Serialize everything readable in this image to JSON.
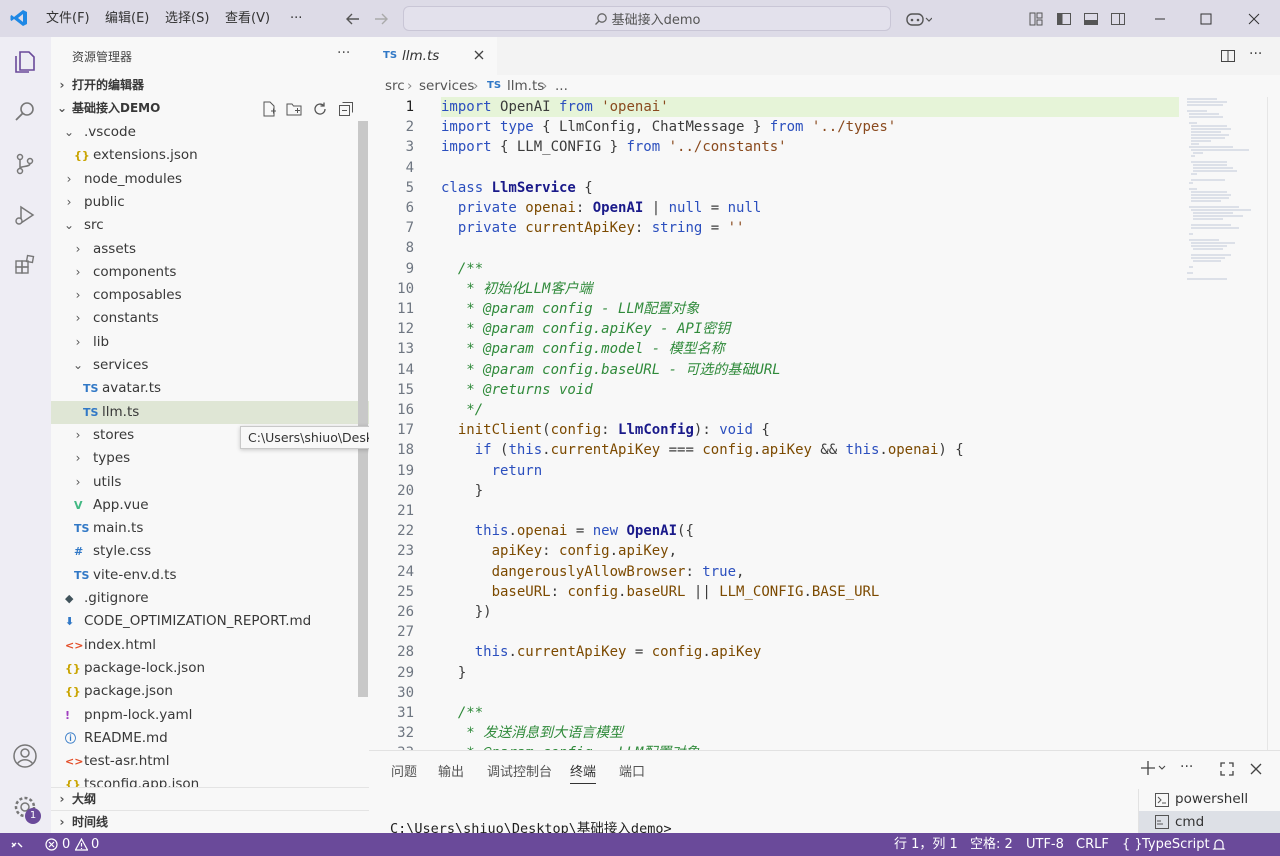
{
  "titlebar": {
    "menus": [
      "文件(F)",
      "编辑(E)",
      "选择(S)",
      "查看(V)"
    ],
    "more": "···",
    "search_text": "基础接入demo"
  },
  "sidebar": {
    "title": "资源管理器",
    "more": "···",
    "open_editors": "打开的编辑器",
    "project": "基础接入DEMO",
    "outline": "大纲",
    "timeline": "时间线",
    "items": [
      {
        "label": ".vscode",
        "chev": "v",
        "icon": "",
        "icon_color": ""
      },
      {
        "label": "extensions.json",
        "chev": "",
        "icon": "{}",
        "icon_color": "#c9a400"
      },
      {
        "label": "node_modules",
        "chev": ">",
        "icon": "",
        "icon_color": ""
      },
      {
        "label": "public",
        "chev": ">",
        "icon": "",
        "icon_color": ""
      },
      {
        "label": "src",
        "chev": "v",
        "icon": "",
        "icon_color": ""
      },
      {
        "label": "assets",
        "chev": ">",
        "icon": "",
        "icon_color": ""
      },
      {
        "label": "components",
        "chev": ">",
        "icon": "",
        "icon_color": ""
      },
      {
        "label": "composables",
        "chev": ">",
        "icon": "",
        "icon_color": ""
      },
      {
        "label": "constants",
        "chev": ">",
        "icon": "",
        "icon_color": ""
      },
      {
        "label": "lib",
        "chev": ">",
        "icon": "",
        "icon_color": ""
      },
      {
        "label": "services",
        "chev": "v",
        "icon": "",
        "icon_color": ""
      },
      {
        "label": "avatar.ts",
        "chev": "",
        "icon": "TS",
        "icon_color": "#3178c6"
      },
      {
        "label": "llm.ts",
        "chev": "",
        "icon": "TS",
        "icon_color": "#3178c6"
      },
      {
        "label": "stores",
        "chev": ">",
        "icon": "",
        "icon_color": ""
      },
      {
        "label": "types",
        "chev": ">",
        "icon": "",
        "icon_color": ""
      },
      {
        "label": "utils",
        "chev": ">",
        "icon": "",
        "icon_color": ""
      },
      {
        "label": "App.vue",
        "chev": "",
        "icon": "V",
        "icon_color": "#41b883"
      },
      {
        "label": "main.ts",
        "chev": "",
        "icon": "TS",
        "icon_color": "#3178c6"
      },
      {
        "label": "style.css",
        "chev": "",
        "icon": "#",
        "icon_color": "#3178c6"
      },
      {
        "label": "vite-env.d.ts",
        "chev": "",
        "icon": "TS",
        "icon_color": "#3178c6"
      },
      {
        "label": ".gitignore",
        "chev": "",
        "icon": "◆",
        "icon_color": "#41535b"
      },
      {
        "label": "CODE_OPTIMIZATION_REPORT.md",
        "chev": "",
        "icon": "⬇",
        "icon_color": "#3178c6"
      },
      {
        "label": "index.html",
        "chev": "",
        "icon": "<>",
        "icon_color": "#e34c26"
      },
      {
        "label": "package-lock.json",
        "chev": "",
        "icon": "{}",
        "icon_color": "#c9a400"
      },
      {
        "label": "package.json",
        "chev": "",
        "icon": "{}",
        "icon_color": "#c9a400"
      },
      {
        "label": "pnpm-lock.yaml",
        "chev": "",
        "icon": "!",
        "icon_color": "#a03fc0"
      },
      {
        "label": "README.md",
        "chev": "",
        "icon": "ⓘ",
        "icon_color": "#3178c6"
      },
      {
        "label": "test-asr.html",
        "chev": "",
        "icon": "<>",
        "icon_color": "#e34c26"
      },
      {
        "label": "tsconfig.app.json",
        "chev": "",
        "icon": "{}",
        "icon_color": "#c9a400"
      }
    ],
    "tooltip": "C:\\Users\\shiuo\\Desktop\\基础接入demo\\src\\services\\llm.ts"
  },
  "editor": {
    "tab_label": "llm.ts",
    "tab_icon": "TS",
    "breadcrumb": [
      "src",
      "services",
      "llm.ts",
      "..."
    ],
    "lines": [
      {
        "n": "1",
        "t": [
          [
            "k",
            "import "
          ],
          [
            "p",
            "OpenAI "
          ],
          [
            "k",
            "from "
          ],
          [
            "s",
            "'openai'"
          ]
        ]
      },
      {
        "n": "2",
        "t": [
          [
            "k",
            "import "
          ],
          [
            "k",
            "type "
          ],
          [
            "p",
            "{ LlmConfig, ChatMessage } "
          ],
          [
            "k",
            "from "
          ],
          [
            "s",
            "'../types'"
          ]
        ]
      },
      {
        "n": "3",
        "t": [
          [
            "k",
            "import "
          ],
          [
            "p",
            "{ LLM_CONFIG } "
          ],
          [
            "k",
            "from "
          ],
          [
            "s",
            "'../constants'"
          ]
        ]
      },
      {
        "n": "4",
        "t": []
      },
      {
        "n": "5",
        "t": [
          [
            "k",
            "class "
          ],
          [
            "ty",
            "LlmService "
          ],
          [
            "p",
            "{"
          ]
        ]
      },
      {
        "n": "6",
        "t": [
          [
            "k",
            "  private "
          ],
          [
            "pr",
            "openai"
          ],
          [
            "p",
            ": "
          ],
          [
            "ty",
            "OpenAI "
          ],
          [
            "p",
            "| "
          ],
          [
            "k",
            "null "
          ],
          [
            "p",
            "= "
          ],
          [
            "k",
            "null"
          ]
        ]
      },
      {
        "n": "7",
        "t": [
          [
            "k",
            "  private "
          ],
          [
            "pr",
            "currentApiKey"
          ],
          [
            "p",
            ": "
          ],
          [
            "k",
            "string "
          ],
          [
            "p",
            "= "
          ],
          [
            "s",
            "''"
          ]
        ]
      },
      {
        "n": "8",
        "t": []
      },
      {
        "n": "9",
        "t": [
          [
            "c",
            "  /**"
          ]
        ]
      },
      {
        "n": "10",
        "t": [
          [
            "c",
            "   * 初始化LLM客户端"
          ]
        ]
      },
      {
        "n": "11",
        "t": [
          [
            "c",
            "   * @param config - LLM配置对象"
          ]
        ]
      },
      {
        "n": "12",
        "t": [
          [
            "c",
            "   * @param config.apiKey - API密钥"
          ]
        ]
      },
      {
        "n": "13",
        "t": [
          [
            "c",
            "   * @param config.model - 模型名称"
          ]
        ]
      },
      {
        "n": "14",
        "t": [
          [
            "c",
            "   * @param config.baseURL - 可选的基础URL"
          ]
        ]
      },
      {
        "n": "15",
        "t": [
          [
            "c",
            "   * @returns void"
          ]
        ]
      },
      {
        "n": "16",
        "t": [
          [
            "c",
            "   */"
          ]
        ]
      },
      {
        "n": "17",
        "t": [
          [
            "p",
            "  "
          ],
          [
            "pr",
            "initClient"
          ],
          [
            "p",
            "("
          ],
          [
            "pr",
            "config"
          ],
          [
            "p",
            ": "
          ],
          [
            "ty",
            "LlmConfig"
          ],
          [
            "p",
            "): "
          ],
          [
            "k",
            "void "
          ],
          [
            "p",
            "{"
          ]
        ]
      },
      {
        "n": "18",
        "t": [
          [
            "k",
            "    if "
          ],
          [
            "p",
            "("
          ],
          [
            "k",
            "this"
          ],
          [
            "p",
            "."
          ],
          [
            "pr",
            "currentApiKey "
          ],
          [
            "p",
            "=== "
          ],
          [
            "pr",
            "config"
          ],
          [
            "p",
            "."
          ],
          [
            "pr",
            "apiKey "
          ],
          [
            "p",
            "&& "
          ],
          [
            "k",
            "this"
          ],
          [
            "p",
            "."
          ],
          [
            "pr",
            "openai"
          ],
          [
            "p",
            ") {"
          ]
        ]
      },
      {
        "n": "19",
        "t": [
          [
            "k",
            "      return"
          ]
        ]
      },
      {
        "n": "20",
        "t": [
          [
            "p",
            "    }"
          ]
        ]
      },
      {
        "n": "21",
        "t": []
      },
      {
        "n": "22",
        "t": [
          [
            "k",
            "    this"
          ],
          [
            "p",
            "."
          ],
          [
            "pr",
            "openai "
          ],
          [
            "p",
            "= "
          ],
          [
            "k",
            "new "
          ],
          [
            "ty",
            "OpenAI"
          ],
          [
            "p",
            "({"
          ]
        ]
      },
      {
        "n": "23",
        "t": [
          [
            "pr",
            "      apiKey"
          ],
          [
            "p",
            ": "
          ],
          [
            "pr",
            "config"
          ],
          [
            "p",
            "."
          ],
          [
            "pr",
            "apiKey"
          ],
          [
            "p",
            ","
          ]
        ]
      },
      {
        "n": "24",
        "t": [
          [
            "pr",
            "      dangerouslyAllowBrowser"
          ],
          [
            "p",
            ": "
          ],
          [
            "k",
            "true"
          ],
          [
            "p",
            ","
          ]
        ]
      },
      {
        "n": "25",
        "t": [
          [
            "pr",
            "      baseURL"
          ],
          [
            "p",
            ": "
          ],
          [
            "pr",
            "config"
          ],
          [
            "p",
            "."
          ],
          [
            "pr",
            "baseURL "
          ],
          [
            "p",
            "|| "
          ],
          [
            "pr",
            "LLM_CONFIG"
          ],
          [
            "p",
            "."
          ],
          [
            "pr",
            "BASE_URL"
          ]
        ]
      },
      {
        "n": "26",
        "t": [
          [
            "p",
            "    })"
          ]
        ]
      },
      {
        "n": "27",
        "t": []
      },
      {
        "n": "28",
        "t": [
          [
            "k",
            "    this"
          ],
          [
            "p",
            "."
          ],
          [
            "pr",
            "currentApiKey "
          ],
          [
            "p",
            "= "
          ],
          [
            "pr",
            "config"
          ],
          [
            "p",
            "."
          ],
          [
            "pr",
            "apiKey"
          ]
        ]
      },
      {
        "n": "29",
        "t": [
          [
            "p",
            "  }"
          ]
        ]
      },
      {
        "n": "30",
        "t": []
      },
      {
        "n": "31",
        "t": [
          [
            "c",
            "  /**"
          ]
        ]
      },
      {
        "n": "32",
        "t": [
          [
            "c",
            "   * 发送消息到大语言模型"
          ]
        ]
      },
      {
        "n": "33",
        "t": [
          [
            "c",
            "   * @param config - LLM配置对象"
          ]
        ]
      }
    ]
  },
  "panel": {
    "tabs": [
      "问题",
      "输出",
      "调试控制台",
      "终端",
      "端口"
    ],
    "active_tab": "终端",
    "terminal_line": "C:\\Users\\shiuo\\Desktop\\基础接入demo>",
    "terminals": [
      "powershell",
      "cmd"
    ]
  },
  "status": {
    "errors": "0",
    "warnings": "0",
    "position": "行 1，列 1",
    "spaces": "空格: 2",
    "encoding": "UTF-8",
    "eol": "CRLF",
    "language": "TypeScript",
    "badge": "1"
  }
}
